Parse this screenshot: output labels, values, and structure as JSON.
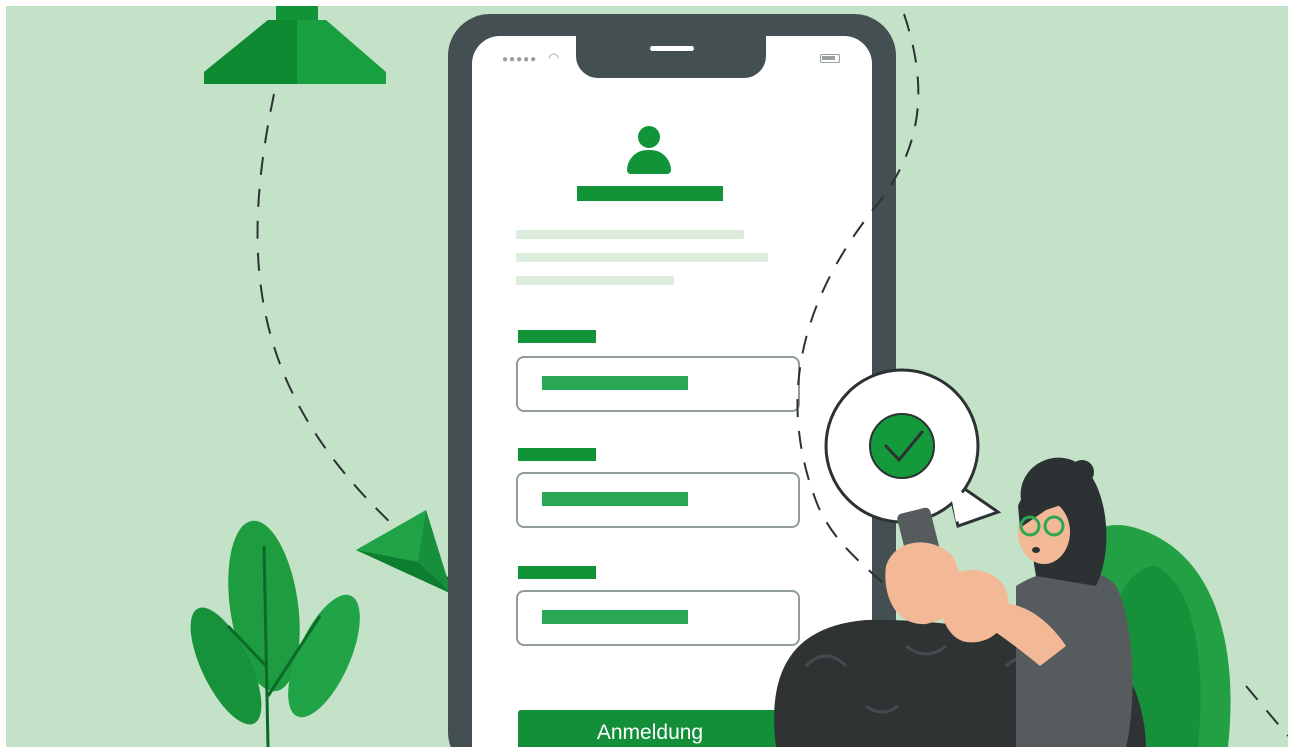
{
  "illustration": {
    "phone": {
      "status_bar": {
        "signal_icon": "signal-dots-icon",
        "wifi_icon": "wifi-icon",
        "battery_icon": "battery-icon"
      },
      "login_form": {
        "avatar_icon": "user-avatar-icon",
        "fields_count_visible": 3,
        "submit_label": "Anmeldung"
      }
    },
    "speech_bubble_icon": "checkmark-icon",
    "decorations": [
      "lamp",
      "paper-plane",
      "plant",
      "woman-with-smartphone",
      "armchair"
    ]
  },
  "colors": {
    "background": "#c4e2c7",
    "brand_green": "#119438",
    "phone_frame": "#434f50",
    "field_fill": "#2aa853"
  }
}
